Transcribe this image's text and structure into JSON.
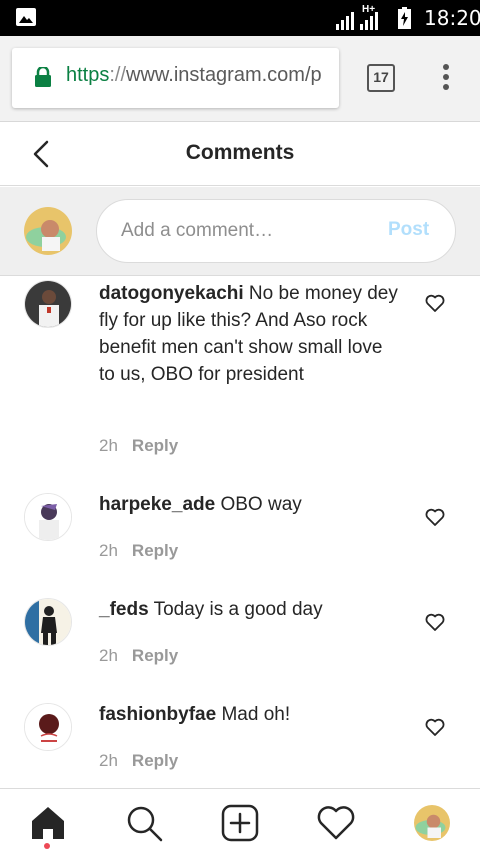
{
  "status_bar": {
    "network": "H+",
    "time": "18:20"
  },
  "browser": {
    "url_scheme": "https",
    "url_sep": "://",
    "url_host": "www.instagram.com/p",
    "tab_count": "17"
  },
  "header": {
    "title": "Comments"
  },
  "composer": {
    "placeholder": "Add a comment…",
    "post_label": "Post"
  },
  "comments": [
    {
      "username": "datogonyekachi",
      "text": " No be money dey fly for up like this? And Aso rock benefit men can't show small love to us, OBO for president",
      "time": "2h",
      "reply": "Reply"
    },
    {
      "username": "harpeke_ade",
      "text": " OBO way",
      "time": "2h",
      "reply": "Reply"
    },
    {
      "username": "_feds",
      "text": " Today is a good day",
      "time": "2h",
      "reply": "Reply"
    },
    {
      "username": "fashionbyfae",
      "text": " Mad oh!",
      "time": "2h",
      "reply": "Reply"
    }
  ],
  "nav": {
    "items": [
      "home-icon",
      "search-icon",
      "new-post-icon",
      "activity-heart-icon",
      "profile-avatar"
    ]
  },
  "colors": {
    "post_disabled": "#b2dffc",
    "secure_green": "#0b8043",
    "notification_dot": "#ed4956"
  }
}
